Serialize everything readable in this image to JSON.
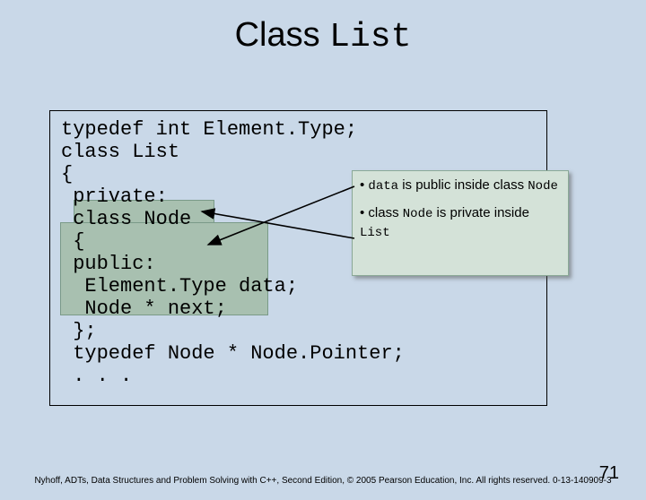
{
  "title": {
    "prefix": "Class ",
    "mono": "List"
  },
  "code": "typedef int Element.Type;\nclass List\n{\n private:\n class Node\n {\n public:\n  Element.Type data;\n  Node * next;\n };\n typedef Node * Node.Pointer;\n . . .",
  "callout": {
    "b1_prefix": "• ",
    "b1_mono1": "data",
    "b1_mid": " is public inside class ",
    "b1_mono2": "Node",
    "b2_prefix": "• class ",
    "b2_mono1": "Node",
    "b2_mid": " is private inside ",
    "b2_mono2": "List"
  },
  "footer": "Nyhoff, ADTs, Data Structures and Problem Solving with C++, Second Edition, © 2005 Pearson Education, Inc. All rights reserved. 0-13-140909-3",
  "pagenum": "71"
}
